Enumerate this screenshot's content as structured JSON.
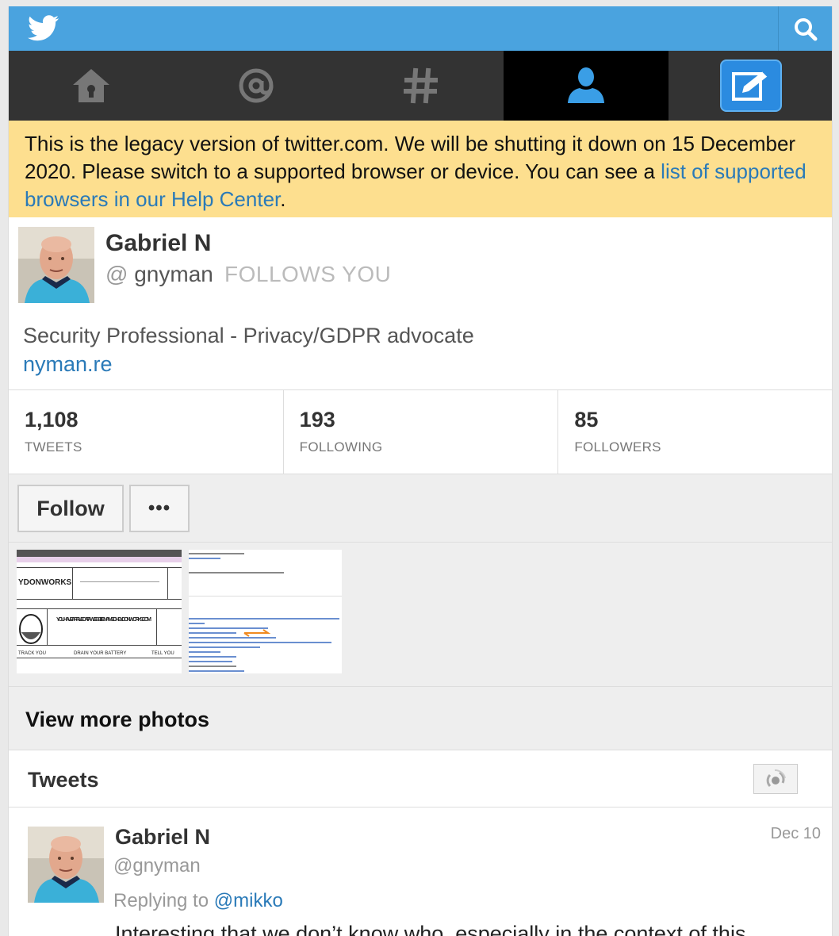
{
  "colors": {
    "brand_blue": "#4aa3df",
    "nav_bg": "#333333",
    "banner_bg": "#fddf8f",
    "link": "#2a7ab8"
  },
  "icons": {
    "logo": "twitter-bird-icon",
    "search": "search-icon",
    "home": "home-icon",
    "mentions": "at-icon",
    "discover": "hashtag-icon",
    "me": "person-icon",
    "compose": "compose-icon",
    "refresh": "refresh-icon"
  },
  "banner": {
    "text": "This is the legacy version of twitter.com. We will be shutting it down on 15 December 2020. Please switch to a supported browser or device. You can see a ",
    "link": "list of supported browsers in our Help Center",
    "end": "."
  },
  "profile": {
    "name": "Gabriel N",
    "at": "@",
    "handle": "gnyman",
    "follows_you": "FOLLOWS YOU",
    "bio": "Security Professional - Privacy/GDPR advocate",
    "url": "nyman.re"
  },
  "stats": [
    {
      "value": "1,108",
      "label": "TWEETS"
    },
    {
      "value": "193",
      "label": "FOLLOWING"
    },
    {
      "value": "85",
      "label": "FOLLOWERS"
    }
  ],
  "actions": {
    "follow": "Follow",
    "more": "•••"
  },
  "photos": {
    "thumb1": {
      "brand": "YDONWORKS",
      "headline": "YOU HAVE ARRIVED AT A WEBSITE NAMED HEYDONWORKS.COM",
      "footer": [
        "TRACK YOU",
        "DRAIN YOUR BATTERY",
        "TELL YOU"
      ]
    },
    "view_more": "View more photos"
  },
  "tweets": {
    "title": "Tweets",
    "items": [
      {
        "name": "Gabriel N",
        "handle": "@gnyman",
        "date": "Dec 10",
        "reply_prefix": "Replying to ",
        "reply_to": "@mikko",
        "text": "Interesting that we don’t know who, especially in the context of this"
      }
    ]
  }
}
